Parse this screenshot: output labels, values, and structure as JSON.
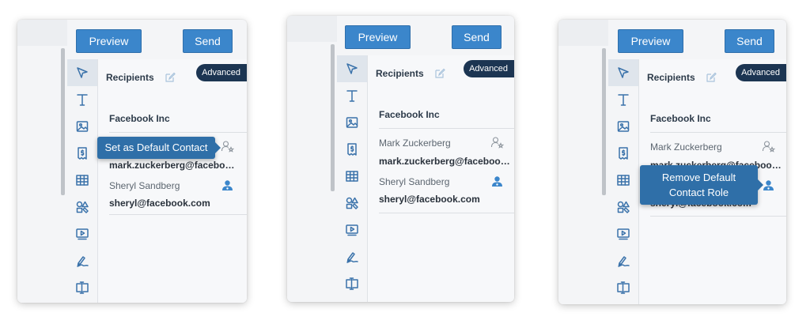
{
  "toolbar": {
    "preview_label": "Preview",
    "send_label": "Send"
  },
  "sidebar": {
    "tools": [
      "pointer-icon",
      "text-icon",
      "image-icon",
      "pricing-icon",
      "table-icon",
      "shapes-icon",
      "video-icon",
      "signature-icon",
      "text-field-icon"
    ],
    "active_tool": "pointer-icon"
  },
  "recipients": {
    "label": "Recipients",
    "advanced_label": "Advanced",
    "company": "Facebook Inc",
    "contacts": [
      {
        "name": "Mark Zuckerberg",
        "email": "mark.zuckerberg@facebook.com"
      },
      {
        "name": "Sheryl Sandberg",
        "email": "sheryl@facebook.com"
      }
    ]
  },
  "panels": [
    {
      "tooltip": "Set as Default Contact"
    },
    {
      "tooltip": ""
    },
    {
      "tooltip_line1": "Remove Default",
      "tooltip_line2": "Contact Role"
    }
  ],
  "colors": {
    "accent": "#3b86cb",
    "dark_badge": "#1c3552",
    "tooltip": "#2f6fa8"
  }
}
